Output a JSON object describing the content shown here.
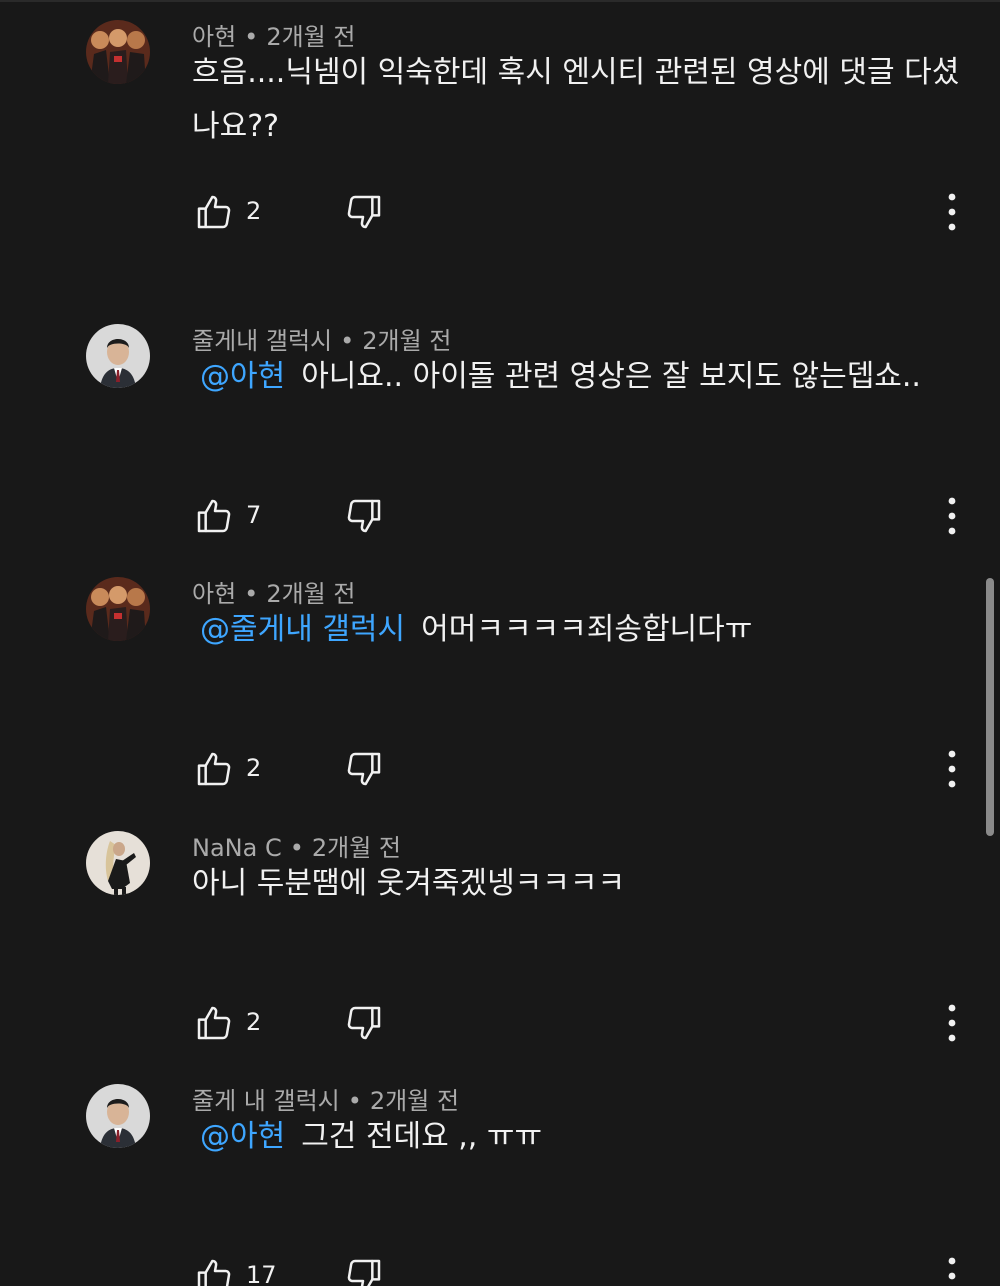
{
  "comments": [
    {
      "author": "아현",
      "time": "2개월 전",
      "mention": "",
      "text": "흐음....닉넴이 익숙한데 혹시 엔시티 관련된 영상에 댓글 다셨나요??",
      "likes": "2"
    },
    {
      "author": "줄게내 갤럭시",
      "time": "2개월 전",
      "mention": "@아현",
      "text": "아니요.. 아이돌 관련 영상은 잘 보지도 않는뎁쇼..",
      "likes": "7"
    },
    {
      "author": "아현",
      "time": "2개월 전",
      "mention": "@줄게내 갤럭시",
      "text": "어머ㅋㅋㅋㅋ죄송합니다ㅠ",
      "likes": "2"
    },
    {
      "author": "NaNa C",
      "time": "2개월 전",
      "mention": "",
      "text": "아니 두분땜에 웃겨죽겠넹ㅋㅋㅋㅋ",
      "likes": "2"
    },
    {
      "author": "줄게 내 갤럭시",
      "time": "2개월 전",
      "mention": "@아현",
      "text": "그건 전데요 ,, ㅠㅠ",
      "likes": "17"
    }
  ],
  "separator": "•",
  "icons": {
    "like": "thumbs-up-icon",
    "dislike": "thumbs-down-icon",
    "more": "more-vertical-icon"
  },
  "colors": {
    "background": "#181818",
    "text": "#f1f1f1",
    "meta": "#aaaaaa",
    "mention": "#3ea6ff"
  }
}
